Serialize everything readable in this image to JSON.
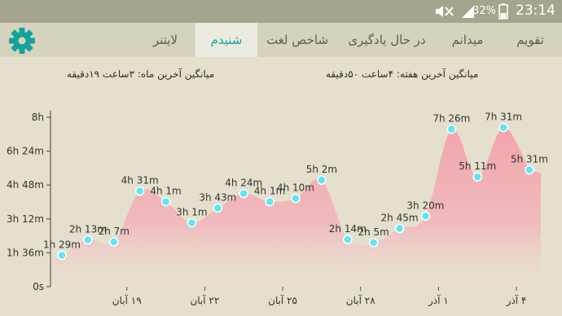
{
  "status_bar": {
    "icons": [
      "mute-icon",
      "signal-icon",
      "battery-icon"
    ],
    "battery_text": "32%",
    "time": "23:14"
  },
  "tabs": [
    {
      "label": "تقویم",
      "active": false
    },
    {
      "label": "میدانم",
      "active": false
    },
    {
      "label": "در حال یادگیری",
      "active": false
    },
    {
      "label": "شاخص لغت",
      "active": false
    },
    {
      "label": "شنیدم",
      "active": true
    },
    {
      "label": "لایتنر",
      "active": false
    }
  ],
  "settings": {
    "icon": "gear-icon"
  },
  "summary": {
    "week": "میانگین آخرین هفته: ۴ساعت ۵۰دقیقه",
    "month": "میانگین آخرین ماه: ۳ساعت ۱۹دقیقه"
  },
  "colors": {
    "accent": "#14a39a",
    "status_bar": "#a6a48f",
    "tab_bar": "#d6d3bd",
    "active_tab": "#ecebdf",
    "background": "#e4e0cd",
    "area_fill": "#f2a9b2",
    "point": "#5ee6f2"
  },
  "chart_data": {
    "type": "area",
    "y_ticks": [
      "0s",
      "1h 36m",
      "3h 12m",
      "4h 48m",
      "6h 24m",
      "8h"
    ],
    "y_tick_values": [
      0,
      96,
      192,
      288,
      384,
      480
    ],
    "ylim": [
      0,
      480
    ],
    "x_ticks": [
      "۱۹ آبان",
      "۲۲ آبان",
      "۲۵ آبان",
      "۲۸ آبان",
      "۱ آذر",
      "۴ آذر"
    ],
    "x_tick_index": [
      2.5,
      5.5,
      8.5,
      11.5,
      14.5,
      17.5
    ],
    "points": [
      {
        "label": "1h 29m",
        "value": 89
      },
      {
        "label": "2h 13m",
        "value": 133
      },
      {
        "label": "2h 7m",
        "value": 127
      },
      {
        "label": "4h 31m",
        "value": 271
      },
      {
        "label": "4h 1m",
        "value": 241
      },
      {
        "label": "3h 1m",
        "value": 181
      },
      {
        "label": "3h 43m",
        "value": 223
      },
      {
        "label": "4h 24m",
        "value": 264
      },
      {
        "label": "4h 1m",
        "value": 241
      },
      {
        "label": "4h 10m",
        "value": 250
      },
      {
        "label": "5h 2m",
        "value": 302
      },
      {
        "label": "2h 14m",
        "value": 134
      },
      {
        "label": "2h 5m",
        "value": 125
      },
      {
        "label": "2h 45m",
        "value": 165
      },
      {
        "label": "3h 20m",
        "value": 200
      },
      {
        "label": "7h 26m",
        "value": 446
      },
      {
        "label": "5h 11m",
        "value": 311
      },
      {
        "label": "7h 31m",
        "value": 451
      },
      {
        "label": "5h 31m",
        "value": 331
      }
    ]
  }
}
